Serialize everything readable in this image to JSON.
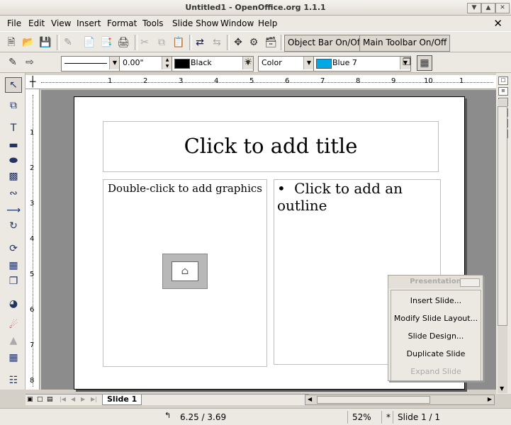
{
  "window": {
    "title": "Untitled1 - OpenOffice.org 1.1.1"
  },
  "menu": [
    "File",
    "Edit",
    "View",
    "Insert",
    "Format",
    "Tools",
    "Slide Show",
    "Window",
    "Help"
  ],
  "toolbar": {
    "object_bar": "Object Bar On/Off",
    "main_toolbar": "Main Toolbar On/Off"
  },
  "format_bar": {
    "line_width": "0.00\"",
    "line_color": "Black",
    "area_style": "Color",
    "area_color": "Blue 7",
    "line_color_swatch": "#000000",
    "area_color_swatch": "#00a8e8"
  },
  "ruler": {
    "h_ticks": [
      "1",
      "2",
      "3",
      "4",
      "5",
      "6",
      "7",
      "8",
      "9",
      "10",
      "1"
    ],
    "v_ticks": [
      "1",
      "2",
      "3",
      "4",
      "5",
      "6",
      "7",
      "8"
    ]
  },
  "slide": {
    "title_placeholder": "Click to add title",
    "graphic_placeholder": "Double-click to add graphics",
    "outline_bullet": "•",
    "outline_placeholder": "Click to add an outline"
  },
  "tabs": {
    "active": "Slide 1"
  },
  "status": {
    "position": "6.25 / 3.69",
    "zoom": "52%",
    "modified": "*",
    "page": "Slide 1 / 1"
  },
  "presentation_panel": {
    "title": "Presentation",
    "items": [
      "Insert Slide...",
      "Modify Slide Layout...",
      "Slide Design...",
      "Duplicate Slide",
      "Expand Slide"
    ]
  }
}
